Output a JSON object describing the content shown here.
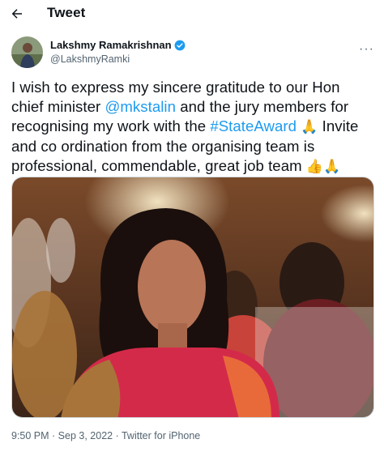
{
  "topbar": {
    "title": "Tweet"
  },
  "author": {
    "name": "Lakshmy Ramakrishnan",
    "handle": "@LakshmyRamki"
  },
  "tweet": {
    "part1": "I wish to express my sincere gratitude to our Hon chief minister ",
    "mention": "@mkstalin",
    "part2": " and the jury members for recognising my work with the ",
    "hashtag": "#StateAward",
    "emoji1": "🙏",
    "part3": " Invite and co ordination from the organising team is professional, commendable, great job team ",
    "emoji2": "👍🙏"
  },
  "meta": {
    "time": "9:50 PM",
    "sep": " · ",
    "date": "Sep 3, 2022",
    "sep2": " · ",
    "source": "Twitter for iPhone"
  },
  "colors": {
    "link": "#1d9bf0",
    "verified": "#1d9bf0",
    "text": "#0f1419",
    "muted": "#536471"
  },
  "icons": {
    "back": "arrow-left-icon",
    "verified": "verified-badge-icon",
    "more": "more-icon"
  }
}
